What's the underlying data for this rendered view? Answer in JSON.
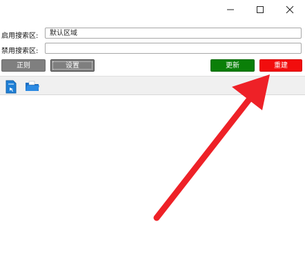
{
  "window": {
    "controls": [
      "minimize-icon",
      "maximize-icon",
      "close-icon"
    ]
  },
  "form": {
    "enabled_label": "启用搜索区:",
    "enabled_value": "默认区域",
    "disabled_label": "禁用搜索区:",
    "disabled_value": ""
  },
  "buttons": {
    "regex": "正则",
    "settings": "设置",
    "update": "更新",
    "rebuild": "重建"
  },
  "toolbar": {
    "icons": [
      "document-icon",
      "folder-icon"
    ]
  },
  "colors": {
    "update_button": "#0a7f08",
    "rebuild_button": "#f20d0d",
    "gray_button": "#7f7f7f",
    "annotation_arrow": "#ee2127",
    "icon_blue": "#1e7fd6"
  }
}
